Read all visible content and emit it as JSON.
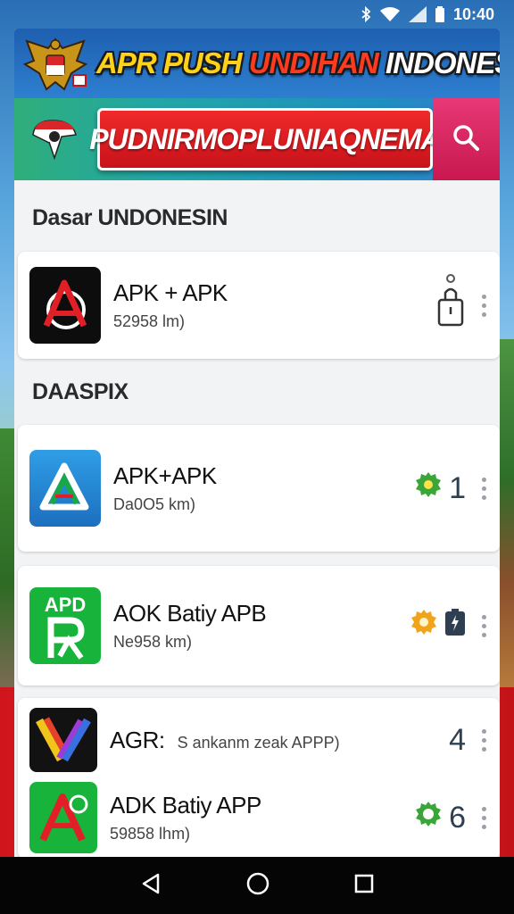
{
  "status_bar": {
    "time": "10:40",
    "icons": [
      "bluetooth-icon",
      "wifi-icon",
      "signal-icon",
      "battery-icon"
    ]
  },
  "banner": {
    "title_part1": "APR PUSH ",
    "title_part2": "UNDIHAN ",
    "title_part3": "INDONESIA",
    "emblem_icon": "garuda-emblem-icon"
  },
  "search": {
    "value": "PUDNIRMOPLUNIAQNEMA",
    "logo_icon": "map-pin-flag-icon",
    "button_icon": "search-icon"
  },
  "sections": [
    {
      "title": "Dasar UNDONESIN",
      "apps": [
        {
          "name": "APK + APK",
          "sub": "52958 lm)",
          "trailing_text": "",
          "trailing_icon": "lock-icon"
        }
      ]
    },
    {
      "title": "DAASPIX",
      "apps": [
        {
          "name": "APK+APK",
          "sub": "Da0O5 km)",
          "trailing_text": "1",
          "trailing_icon": "green-gear-icon"
        },
        {
          "name": "AOK Batiy APB",
          "sub": "Ne958 km)",
          "icon_label": "APD",
          "trailing_text": "",
          "trailing_icon": "orange-gear-battery-icon"
        },
        {
          "name": "AGR:",
          "sub": "S ankanm zeak APPP)",
          "trailing_text": "4",
          "trailing_icon": ""
        },
        {
          "name": "ADK Batiy APP",
          "sub": "59858 lhm)",
          "trailing_text": "6",
          "trailing_icon": "green-refresh-icon"
        }
      ]
    }
  ],
  "colors": {
    "search_field": "#c8121a",
    "search_button": "#c8184e",
    "accent_yellow": "#ffd21a",
    "status_green": "#3aa63a"
  },
  "nav": {
    "back_icon": "back-triangle-icon",
    "home_icon": "home-circle-icon",
    "recents_icon": "recents-square-icon"
  }
}
